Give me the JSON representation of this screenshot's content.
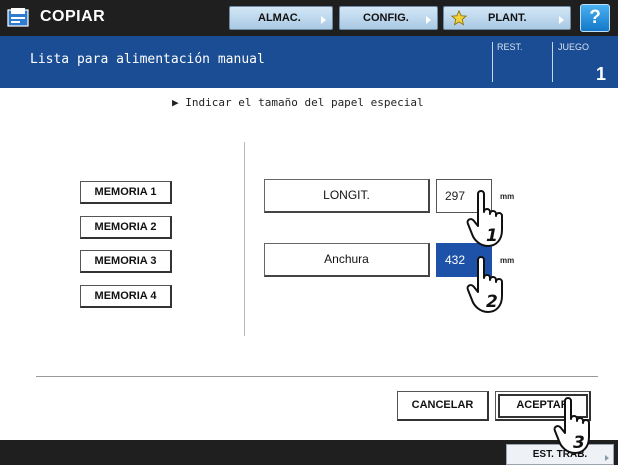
{
  "app": {
    "title": "COPIAR",
    "icon": "copier-icon"
  },
  "top_buttons": [
    {
      "label": "ALMAC.",
      "icon": ""
    },
    {
      "label": "CONFIG.",
      "icon": ""
    },
    {
      "label": "PLANT.",
      "icon": "star-icon"
    }
  ],
  "help": {
    "label": "?"
  },
  "header": {
    "title": "Lista para alimentación manual",
    "rest_label": "REST.",
    "juego_label": "JUEGO",
    "juego_value": "1"
  },
  "instruction": "▶ Indicar el tamaño del papel especial",
  "memory_buttons": [
    "MEMORIA 1",
    "MEMORIA 2",
    "MEMORIA 3",
    "MEMORIA 4"
  ],
  "dimensions": {
    "length": {
      "label": "LONGIT.",
      "value": "297",
      "unit": "mm",
      "step": "1"
    },
    "width": {
      "label": "Anchura",
      "value": "432",
      "unit": "mm",
      "step": "2"
    }
  },
  "actions": {
    "cancel": "CANCELAR",
    "accept": "ACEPTAR",
    "accept_step": "3"
  },
  "status": {
    "label": "EST. TRAB."
  },
  "colors": {
    "topbar": "#1f1f1f",
    "header": "#1b4d94",
    "active_field": "#1d52a8",
    "top_button": "#bcd8ef",
    "help_button": "#1e8ee0"
  }
}
